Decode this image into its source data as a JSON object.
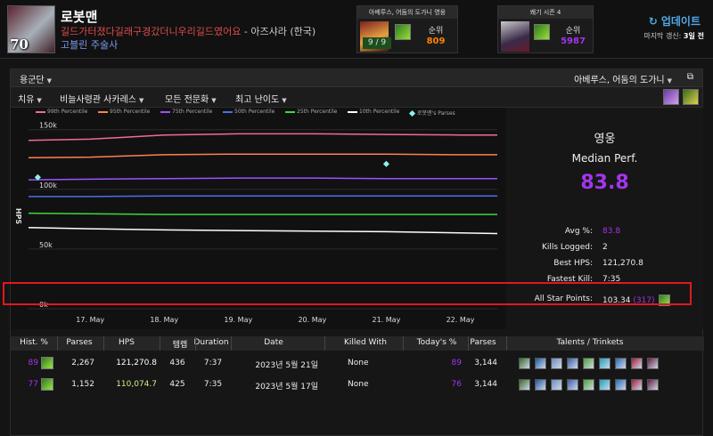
{
  "header": {
    "character": {
      "name": "로봇맨",
      "level": "70",
      "guild": "길드가터졌다길래구경갔더니우리길드였어요",
      "separator": " - ",
      "realm": "아즈샤라 (한국)",
      "class_spec": "고블린 주술사"
    },
    "encounter_rank": {
      "title": "아베루스, 어둠의 도가니 영웅",
      "kills": "9 / 9",
      "rank_label": "순위",
      "rank_value": "809",
      "value_color": "#ff8000"
    },
    "season_rank": {
      "title": "쐐기 시즌 4",
      "rank_label": "순위",
      "rank_value": "5987",
      "value_color": "#a335ee"
    },
    "update_label": "업데이트",
    "last_updated_label": "마지막 갱신:",
    "last_updated_value": "3일 전"
  },
  "toolbar": {
    "zone_filter": "용군단",
    "raid_filter": "아베루스, 어둠의 도가니",
    "metric": "치유",
    "boss": "비늘사령관 사카레스",
    "spec": "모든 전문화",
    "difficulty": "최고 난이도"
  },
  "chart_data": {
    "type": "line",
    "ylabel": "HPS",
    "x_ticks": [
      "17. May",
      "18. May",
      "19. May",
      "20. May",
      "21. May",
      "22. May"
    ],
    "y_ticks": [
      "0k",
      "50k",
      "100k",
      "150k"
    ],
    "xlim": [
      "2023-05-16T16:00",
      "2023-05-23T00:00"
    ],
    "ylim": [
      0,
      155000
    ],
    "x": [
      "2023-05-16T16:00",
      "2023-05-17T12:00",
      "2023-05-18T12:00",
      "2023-05-19T12:00",
      "2023-05-20T12:00",
      "2023-05-21T12:00",
      "2023-05-22T12:00",
      "2023-05-23T00:00"
    ],
    "series": [
      {
        "name": "99th Percentile",
        "color": "#f36a9a",
        "values": [
          141000,
          142000,
          145500,
          146500,
          146500,
          146000,
          145500,
          145500
        ]
      },
      {
        "name": "95th Percentile",
        "color": "#ff8050",
        "values": [
          126500,
          127000,
          129000,
          129500,
          129500,
          129500,
          129000,
          129000
        ]
      },
      {
        "name": "75th Percentile",
        "color": "#a050ff",
        "values": [
          108000,
          108500,
          109000,
          109500,
          109500,
          109000,
          109000,
          109000
        ]
      },
      {
        "name": "50th Percentile",
        "color": "#4a6ef0",
        "values": [
          94000,
          94000,
          94500,
          94500,
          94500,
          94500,
          94500,
          94500
        ]
      },
      {
        "name": "25th Percentile",
        "color": "#3ed83e",
        "values": [
          80000,
          79500,
          79000,
          79000,
          79000,
          79000,
          79000,
          79000
        ]
      },
      {
        "name": "10th Percentile",
        "color": "#ffffff",
        "values": [
          68000,
          67000,
          66000,
          65500,
          65000,
          64500,
          63500,
          63000
        ]
      }
    ],
    "parses": {
      "name": "로봇맨's Parses",
      "color": "#8ff0f0",
      "points": [
        {
          "x": "2023-05-16T19:00",
          "y": 110075
        },
        {
          "x": "2023-05-21T12:00",
          "y": 121271
        }
      ]
    },
    "legend": "top",
    "grid": true
  },
  "summary": {
    "title": "영웅",
    "subtitle": "Median Perf.",
    "median": "83.8",
    "stats": [
      {
        "label": "Avg %:",
        "value": "83.8",
        "color": "#a335ee"
      },
      {
        "label": "Kills Logged:",
        "value": "2",
        "color": "#eeeeee"
      },
      {
        "label": "Best HPS:",
        "value": "121,270.8",
        "color": "#eeeeee"
      },
      {
        "label": "Fastest Kill:",
        "value": "7:35",
        "color": "#eeeeee"
      },
      {
        "label": "All Star Points:",
        "value": "103.34",
        "extra": "(317)",
        "color": "#eeeeee",
        "extra_color": "#a335ee"
      }
    ]
  },
  "table": {
    "headers": [
      "Hist. %",
      "Parses",
      "HPS",
      "템렙",
      "Duration",
      "Date",
      "Killed With",
      "Today's %",
      "Parses",
      "Talents / Trinkets"
    ],
    "rows": [
      {
        "hist": "89",
        "parses": "2,267",
        "hps": "121,270.8",
        "ilvl": "436",
        "duration": "7:37",
        "date": "2023년 5월 21일",
        "killed_with": "None",
        "today": "89",
        "parses2": "3,144",
        "hist_color": "#a335ee",
        "hps_color": "#ffffff"
      },
      {
        "hist": "77",
        "parses": "1,152",
        "hps": "110,074.7",
        "ilvl": "425",
        "duration": "7:35",
        "date": "2023년 5월 17일",
        "killed_with": "None",
        "today": "76",
        "parses2": "3,144",
        "hist_color": "#a335ee",
        "hps_color": "#ccee88"
      }
    ],
    "talent_icons": [
      "#3a6a2a",
      "#1d5a9a",
      "#6d8dbd",
      "#3b5fa9",
      "#4ca03a",
      "#1fa0c0",
      "#2a6ab0",
      "#a02040",
      "#602040"
    ]
  }
}
